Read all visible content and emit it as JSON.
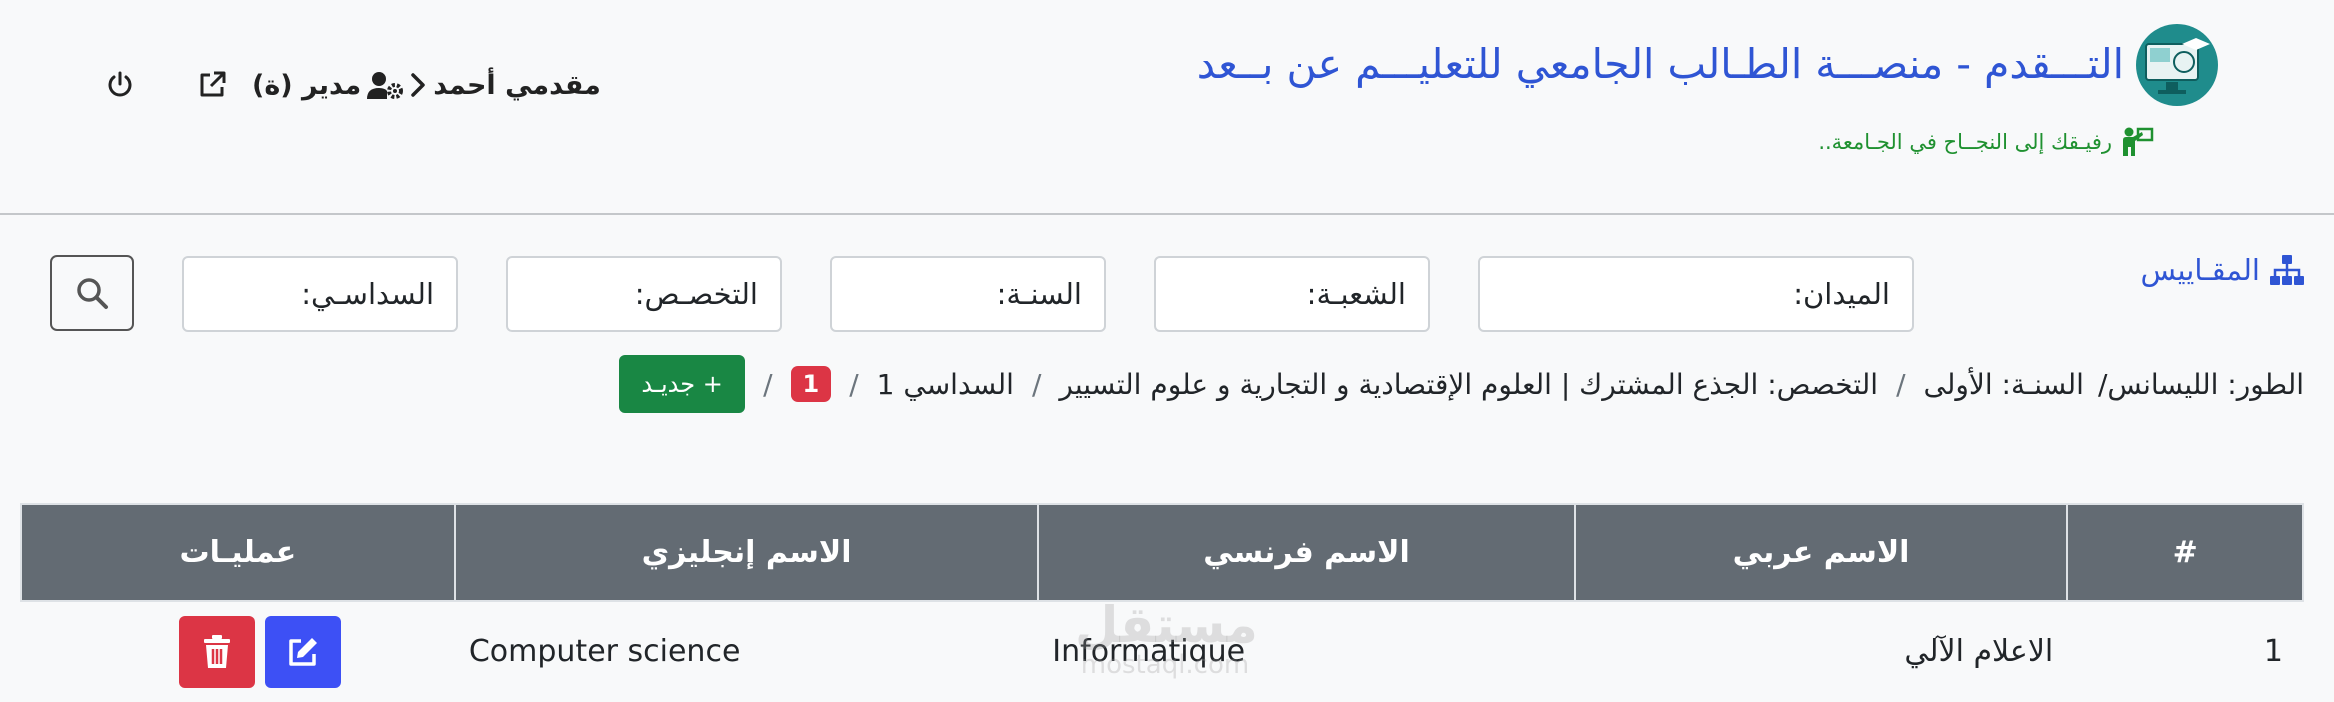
{
  "header": {
    "title": "التـــقدم - منصـــة الطـالب الجامعي للتعليـــم عن بــعد",
    "subtitle": "رفيـقك إلى النجــاح في الجـامعة..",
    "user_name": "مقدمي أحمد",
    "user_role": "مدير (ة)"
  },
  "filters": {
    "measures_label": "المقـاييس",
    "field": "الميدان:",
    "branch": "الشعبـة:",
    "year": "السنـة:",
    "specialty": "التخصـص:",
    "semester": "السداسـي:"
  },
  "breadcrumb": {
    "level": "الطور: الليسانس/",
    "year": "السنـة: الأولى",
    "specialty": "التخصص: الجذع المشترك | العلوم الإقتصادية و التجارية و علوم التسيير",
    "semester": "السداسي 1",
    "count_badge": "1",
    "new_button": "+ جديـد"
  },
  "table": {
    "headers": [
      "#",
      "الاسم عربي",
      "الاسم فرنسي",
      "الاسم إنجليزي",
      "عمليـات"
    ],
    "rows": [
      {
        "num": "1",
        "arabic": "الاعلام الآلي",
        "french": "Informatique",
        "english": "Computer science"
      }
    ]
  },
  "watermark": {
    "big": "مستقل",
    "small": "mostaql.com"
  },
  "colors": {
    "primary": "#2f55d4",
    "success": "#198744",
    "danger": "#dc3545",
    "header_bg": "#636b73",
    "edit": "#3d50f5"
  }
}
